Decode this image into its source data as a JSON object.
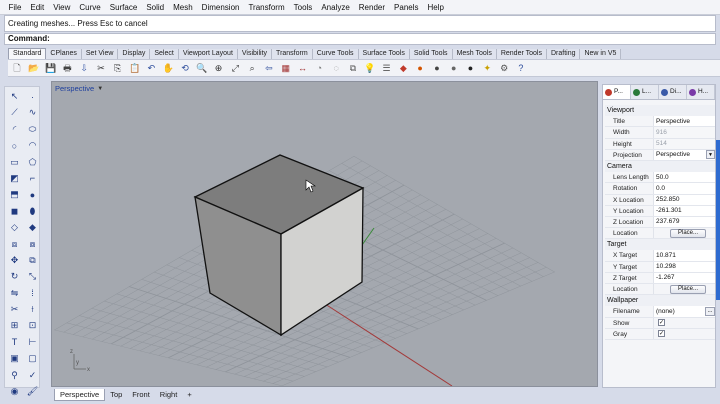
{
  "menu": [
    "File",
    "Edit",
    "View",
    "Curve",
    "Surface",
    "Solid",
    "Mesh",
    "Dimension",
    "Transform",
    "Tools",
    "Analyze",
    "Render",
    "Panels",
    "Help"
  ],
  "command_history": "Creating meshes... Press Esc to cancel",
  "command_prompt": "Command:",
  "toolbar_tabs": [
    "Standard",
    "CPlanes",
    "Set View",
    "Display",
    "Select",
    "Viewport Layout",
    "Visibility",
    "Transform",
    "Curve Tools",
    "Surface Tools",
    "Solid Tools",
    "Mesh Tools",
    "Render Tools",
    "Drafting",
    "New in V5"
  ],
  "toolbar_icons": [
    {
      "name": "new-file-icon",
      "glyph": "🗋",
      "color": "#555"
    },
    {
      "name": "open-icon",
      "glyph": "📂",
      "color": "#c89a22"
    },
    {
      "name": "save-icon",
      "glyph": "💾",
      "color": "#3a5aa8"
    },
    {
      "name": "print-icon",
      "glyph": "🖶",
      "color": "#444"
    },
    {
      "name": "import-icon",
      "glyph": "⇩",
      "color": "#3a5aa8"
    },
    {
      "name": "cut-icon",
      "glyph": "✂",
      "color": "#333"
    },
    {
      "name": "copy-icon",
      "glyph": "⎘",
      "color": "#333"
    },
    {
      "name": "paste-icon",
      "glyph": "📋",
      "color": "#a07a2a"
    },
    {
      "name": "undo-icon",
      "glyph": "↶",
      "color": "#2a4a9a"
    },
    {
      "name": "pan-icon",
      "glyph": "✋",
      "color": "#555"
    },
    {
      "name": "rotate-view-icon",
      "glyph": "⟲",
      "color": "#2a4a9a"
    },
    {
      "name": "zoom-icon",
      "glyph": "🔍",
      "color": "#333"
    },
    {
      "name": "zoom-window-icon",
      "glyph": "⊕",
      "color": "#333"
    },
    {
      "name": "zoom-extents-icon",
      "glyph": "⤢",
      "color": "#333"
    },
    {
      "name": "zoom-selected-icon",
      "glyph": "⌕",
      "color": "#333"
    },
    {
      "name": "undo-view-icon",
      "glyph": "⇦",
      "color": "#2a4a9a"
    },
    {
      "name": "grid-icon",
      "glyph": "▦",
      "color": "#a03030"
    },
    {
      "name": "dimension-icon",
      "glyph": "↔",
      "color": "#a03030"
    },
    {
      "name": "object-snap-icon",
      "glyph": "◔",
      "color": "#777"
    },
    {
      "name": "hide-icon",
      "glyph": "◌",
      "color": "#777"
    },
    {
      "name": "layer-icon",
      "glyph": "⧉",
      "color": "#555"
    },
    {
      "name": "lightbulb-icon",
      "glyph": "💡",
      "color": "#c9a000"
    },
    {
      "name": "properties-icon",
      "glyph": "☰",
      "color": "#555"
    },
    {
      "name": "material-icon",
      "glyph": "◆",
      "color": "#c0392b"
    },
    {
      "name": "color-wheel-icon",
      "glyph": "●",
      "color": "#d35400"
    },
    {
      "name": "render-sphere-icon",
      "glyph": "●",
      "color": "#444"
    },
    {
      "name": "shaded-sphere-icon",
      "glyph": "●",
      "color": "#666"
    },
    {
      "name": "rendered-sphere-icon",
      "glyph": "●",
      "color": "#222"
    },
    {
      "name": "light-icon",
      "glyph": "✦",
      "color": "#c9a000"
    },
    {
      "name": "options-icon",
      "glyph": "⚙",
      "color": "#555"
    },
    {
      "name": "help-icon",
      "glyph": "?",
      "color": "#2a4a9a"
    }
  ],
  "left_icons": [
    {
      "name": "select-arrow-icon",
      "glyph": "↖"
    },
    {
      "name": "point-icon",
      "glyph": "·"
    },
    {
      "name": "polyline-icon",
      "glyph": "⟋"
    },
    {
      "name": "curve-icon",
      "glyph": "∿"
    },
    {
      "name": "arc-icon",
      "glyph": "◜"
    },
    {
      "name": "ellipse-icon",
      "glyph": "⬭"
    },
    {
      "name": "circle-icon",
      "glyph": "○"
    },
    {
      "name": "arc-tool-icon",
      "glyph": "◠"
    },
    {
      "name": "rectangle-icon",
      "glyph": "▭"
    },
    {
      "name": "polygon-icon",
      "glyph": "⬠"
    },
    {
      "name": "surface-icon",
      "glyph": "◩"
    },
    {
      "name": "fillet-icon",
      "glyph": "⌐"
    },
    {
      "name": "extrude-icon",
      "glyph": "⬒"
    },
    {
      "name": "sphere-icon",
      "glyph": "●"
    },
    {
      "name": "box-icon",
      "glyph": "◼"
    },
    {
      "name": "cylinder-icon",
      "glyph": "⬮"
    },
    {
      "name": "mesh-icon",
      "glyph": "◇"
    },
    {
      "name": "planar-surface-icon",
      "glyph": "◆"
    },
    {
      "name": "boolean-union-icon",
      "glyph": "⧈"
    },
    {
      "name": "boolean-diff-icon",
      "glyph": "⧇"
    },
    {
      "name": "move-icon",
      "glyph": "✥"
    },
    {
      "name": "copy-object-icon",
      "glyph": "⧉"
    },
    {
      "name": "rotate-icon",
      "glyph": "↻"
    },
    {
      "name": "scale-icon",
      "glyph": "⤡"
    },
    {
      "name": "mirror-icon",
      "glyph": "⇋"
    },
    {
      "name": "array-icon",
      "glyph": "⁞"
    },
    {
      "name": "trim-icon",
      "glyph": "✂"
    },
    {
      "name": "split-icon",
      "glyph": "⟊"
    },
    {
      "name": "join-icon",
      "glyph": "⊞"
    },
    {
      "name": "explode-icon",
      "glyph": "⊡"
    },
    {
      "name": "text-icon",
      "glyph": "T"
    },
    {
      "name": "dimension-tool-icon",
      "glyph": "⊢"
    },
    {
      "name": "group-icon",
      "glyph": "▣"
    },
    {
      "name": "ungroup-icon",
      "glyph": "▢"
    },
    {
      "name": "analyze-icon",
      "glyph": "⚲"
    },
    {
      "name": "check-icon",
      "glyph": "✓"
    },
    {
      "name": "render-icon",
      "glyph": "◉"
    },
    {
      "name": "paint-icon",
      "glyph": "🖌"
    }
  ],
  "viewport": {
    "title": "Perspective",
    "tabs": [
      "Perspective",
      "Top",
      "Front",
      "Right"
    ],
    "add_tab": "+"
  },
  "panel": {
    "tabs": [
      "P...",
      "L...",
      "Di...",
      "H..."
    ],
    "sections": [
      {
        "title": "Viewport",
        "rows": [
          {
            "label": "Title",
            "value": "Perspective"
          },
          {
            "label": "Width",
            "value": "916",
            "grey": true
          },
          {
            "label": "Height",
            "value": "514",
            "grey": true
          },
          {
            "label": "Projection",
            "value": "Perspective",
            "dropdown": true
          }
        ]
      },
      {
        "title": "Camera",
        "rows": [
          {
            "label": "Lens Length",
            "value": "50.0"
          },
          {
            "label": "Rotation",
            "value": "0.0"
          },
          {
            "label": "X Location",
            "value": "252.850"
          },
          {
            "label": "Y Location",
            "value": "-261.301"
          },
          {
            "label": "Z Location",
            "value": "237.679"
          },
          {
            "label": "Location",
            "button": "Place..."
          }
        ]
      },
      {
        "title": "Target",
        "rows": [
          {
            "label": "X Target",
            "value": "10.871"
          },
          {
            "label": "Y Target",
            "value": "10.298"
          },
          {
            "label": "Z Target",
            "value": "-1.267"
          },
          {
            "label": "Location",
            "button": "Place..."
          }
        ]
      },
      {
        "title": "Wallpaper",
        "rows": [
          {
            "label": "Filename",
            "value": "(none)",
            "ellipsis": true
          },
          {
            "label": "Show",
            "check": "✓"
          },
          {
            "label": "Gray",
            "check": "✓"
          }
        ]
      }
    ]
  },
  "colors": {
    "viewport_bg": "#a4a8af",
    "grid": "#8f949b",
    "x_axis": "#a33a3a",
    "y_axis": "#3a8a3a",
    "accent": "#1e3f9e"
  }
}
